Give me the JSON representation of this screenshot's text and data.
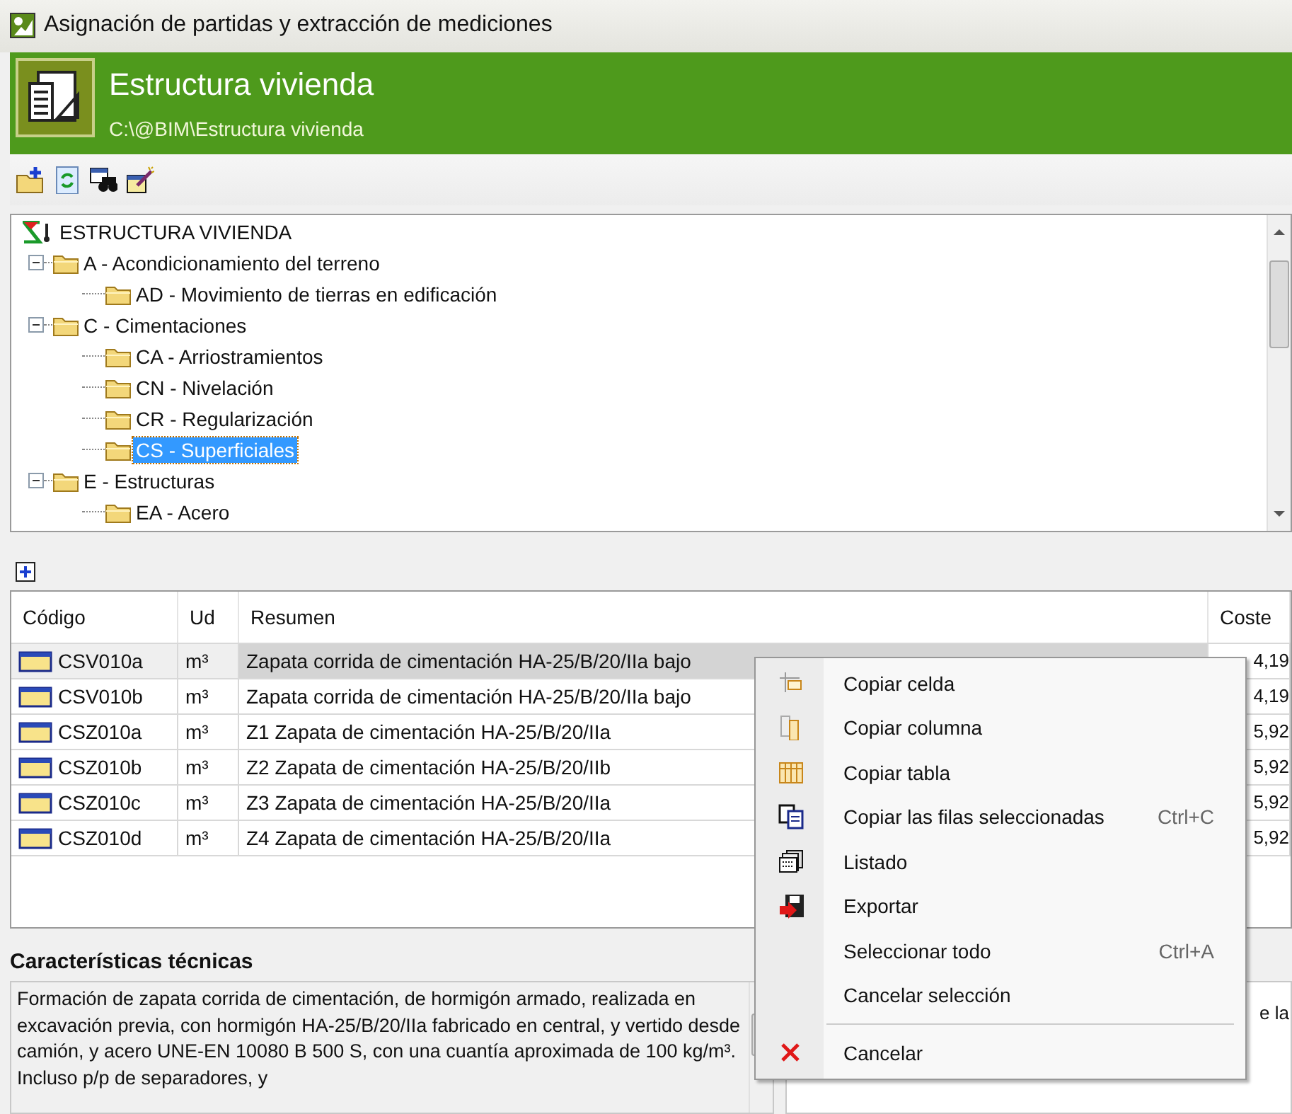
{
  "window": {
    "title": "Asignación de partidas y extracción de mediciones"
  },
  "header": {
    "title": "Estructura vivienda",
    "path": "C:\\@BIM\\Estructura vivienda"
  },
  "toolbar": [
    {
      "kind": "new-folder"
    },
    {
      "kind": "refresh"
    },
    {
      "kind": "find"
    },
    {
      "kind": "wand"
    }
  ],
  "tree": {
    "root": {
      "label": "ESTRUCTURA VIVIENDA",
      "children": [
        {
          "label": "A - Acondicionamiento del terreno",
          "expanded": true,
          "selected": false,
          "children": [
            {
              "label": "AD - Movimiento de tierras en edificación",
              "selected": false
            }
          ]
        },
        {
          "label": "C - Cimentaciones",
          "expanded": true,
          "selected": false,
          "children": [
            {
              "label": "CA - Arriostramientos",
              "selected": false
            },
            {
              "label": "CN - Nivelación",
              "selected": false
            },
            {
              "label": "CR - Regularización",
              "selected": false
            },
            {
              "label": "CS - Superficiales",
              "selected": true
            }
          ]
        },
        {
          "label": "E - Estructuras",
          "expanded": true,
          "selected": false,
          "children": [
            {
              "label": "EA - Acero",
              "selected": false
            }
          ]
        }
      ]
    }
  },
  "table": {
    "columns": [
      "Código",
      "Ud",
      "Resumen",
      "Coste"
    ],
    "rows": [
      {
        "code": "CSV010a",
        "unit": "m³",
        "summary": "Zapata corrida de cimentación HA-25/B/20/IIa bajo",
        "cost": "4,19",
        "selected": true
      },
      {
        "code": "CSV010b",
        "unit": "m³",
        "summary": "Zapata corrida de cimentación HA-25/B/20/IIa bajo",
        "cost": "4,19",
        "selected": false
      },
      {
        "code": "CSZ010a",
        "unit": "m³",
        "summary": "Z1 Zapata de cimentación HA-25/B/20/IIa",
        "cost": "5,92",
        "selected": false
      },
      {
        "code": "CSZ010b",
        "unit": "m³",
        "summary": "Z2 Zapata de cimentación HA-25/B/20/IIb",
        "cost": "5,92",
        "selected": false
      },
      {
        "code": "CSZ010c",
        "unit": "m³",
        "summary": "Z3 Zapata de cimentación HA-25/B/20/IIa",
        "cost": "5,92",
        "selected": false
      },
      {
        "code": "CSZ010d",
        "unit": "m³",
        "summary": "Z4 Zapata de cimentación HA-25/B/20/IIa",
        "cost": "5,92",
        "selected": false
      }
    ]
  },
  "details": {
    "heading": "Características técnicas",
    "text": "Formación de zapata corrida de cimentación, de hormigón armado, realizada en excavación previa, con hormigón HA-25/B/20/IIa fabricado en central, y vertido desde camión, y acero UNE-EN 10080 B 500 S, con una cuantía aproximada de 100 kg/m³. Incluso p/p de separadores, y",
    "side_text": "e la"
  },
  "context_menu": [
    {
      "kind": "item",
      "label": "Copiar celda"
    },
    {
      "kind": "item",
      "label": "Copiar columna"
    },
    {
      "kind": "item",
      "label": "Copiar tabla"
    },
    {
      "kind": "item",
      "label": "Copiar las filas seleccionadas",
      "shortcut": "Ctrl+C"
    },
    {
      "kind": "item",
      "label": "Listado"
    },
    {
      "kind": "item",
      "label": "Exportar"
    },
    {
      "kind": "item",
      "label": "Seleccionar todo",
      "shortcut": "Ctrl+A"
    },
    {
      "kind": "item",
      "label": "Cancelar selección"
    },
    {
      "kind": "separator"
    },
    {
      "kind": "item",
      "label": "Cancelar"
    }
  ]
}
